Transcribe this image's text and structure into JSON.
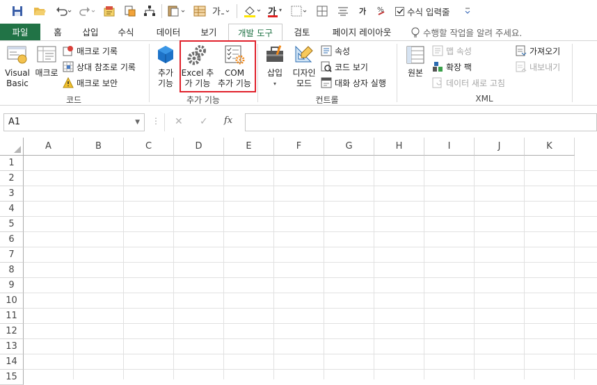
{
  "quick_access": {
    "icons": [
      "save-icon",
      "open-icon",
      "undo-icon",
      "redo-icon",
      "macro-icon",
      "copy-format-icon",
      "hierarchy-icon",
      "paste-icon",
      "table-icon",
      "font-style-icon",
      "fill-color-icon",
      "font-color-icon",
      "borders-icon",
      "cell-icon",
      "align-icon",
      "font-size-icon",
      "percent-icon",
      "customize-icon"
    ],
    "font_color_glyph": "가",
    "font_size_glyph": "가",
    "formula_toggle_label": "수식 입력줄",
    "formula_toggle_checked": true
  },
  "tabs": [
    {
      "label": "파일"
    },
    {
      "label": "홈"
    },
    {
      "label": "삽입"
    },
    {
      "label": "수식"
    },
    {
      "label": "데이터"
    },
    {
      "label": "보기"
    },
    {
      "label": "개발 도구"
    },
    {
      "label": "검토"
    },
    {
      "label": "페이지 레이아웃"
    }
  ],
  "active_tab": "개발 도구",
  "tell_me": "수행할 작업을 알려 주세요.",
  "ribbon": {
    "code": {
      "label": "코드",
      "visual_basic": "Visual Basic",
      "visual_basic_line1": "Visual",
      "visual_basic_line2": "Basic",
      "macros": "매크로",
      "record_macro": "매크로 기록",
      "relative_ref": "상대 참조로 기록",
      "macro_security": "매크로 보안"
    },
    "addins": {
      "label": "추가 기능",
      "addins_line1": "추가",
      "addins_line2": "기능",
      "excel_addins_line1": "Excel 추",
      "excel_addins_line2": "가 기능",
      "com_addins_line1": "COM",
      "com_addins_line2": "추가 기능"
    },
    "controls": {
      "label": "컨트롤",
      "insert": "삽입",
      "design_mode_line1": "디자인",
      "design_mode_line2": "모드",
      "properties": "속성",
      "view_code": "코드 보기",
      "run_dialog": "대화 상자 실행"
    },
    "xml": {
      "label": "XML",
      "source": "원본",
      "map_properties": "맵 속성",
      "expansion_packs": "확장 팩",
      "refresh_data": "데이터 새로 고침",
      "import": "가져오기",
      "export": "내보내기"
    }
  },
  "formula_bar": {
    "name_box": "A1",
    "cancel_glyph": "✕",
    "enter_glyph": "✓",
    "fx_glyph": "fx",
    "value": ""
  },
  "sheet": {
    "columns": [
      "A",
      "B",
      "C",
      "D",
      "E",
      "F",
      "G",
      "H",
      "I",
      "J",
      "K"
    ],
    "rows": [
      "1",
      "2",
      "3",
      "4",
      "5",
      "6",
      "7",
      "8",
      "9",
      "10",
      "11",
      "12",
      "13",
      "14",
      "15"
    ]
  },
  "colors": {
    "file_tab": "#217346",
    "active_tab_text": "#217346",
    "highlight_border": "#e0202a",
    "grid_line": "#e1e1e1"
  }
}
